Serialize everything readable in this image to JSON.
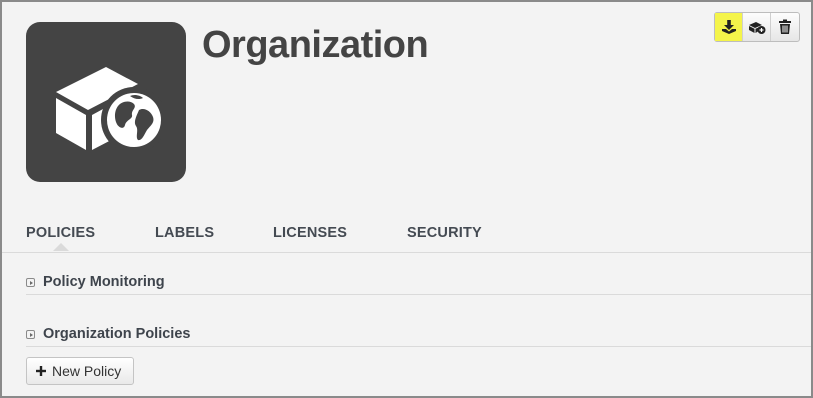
{
  "header": {
    "title": "Organization",
    "icon": "organization-box-globe-icon"
  },
  "toolbar": {
    "buttons": [
      {
        "icon": "import-download-icon",
        "highlighted": true
      },
      {
        "icon": "add-to-group-icon",
        "highlighted": false
      },
      {
        "icon": "trash-icon",
        "highlighted": false
      }
    ],
    "highlight_color": "#f4f44a"
  },
  "tabs": [
    {
      "label": "POLICIES",
      "active": true
    },
    {
      "label": "LABELS",
      "active": false
    },
    {
      "label": "LICENSES",
      "active": false
    },
    {
      "label": "SECURITY",
      "active": false
    }
  ],
  "sections": [
    {
      "label": "Policy Monitoring",
      "icon": "expand-arrow-icon"
    },
    {
      "label": "Organization Policies",
      "icon": "expand-arrow-icon"
    }
  ],
  "actions": {
    "new_policy_label": "New Policy"
  },
  "colors": {
    "icon_tile": "#444444",
    "background": "#f3f3f3"
  }
}
